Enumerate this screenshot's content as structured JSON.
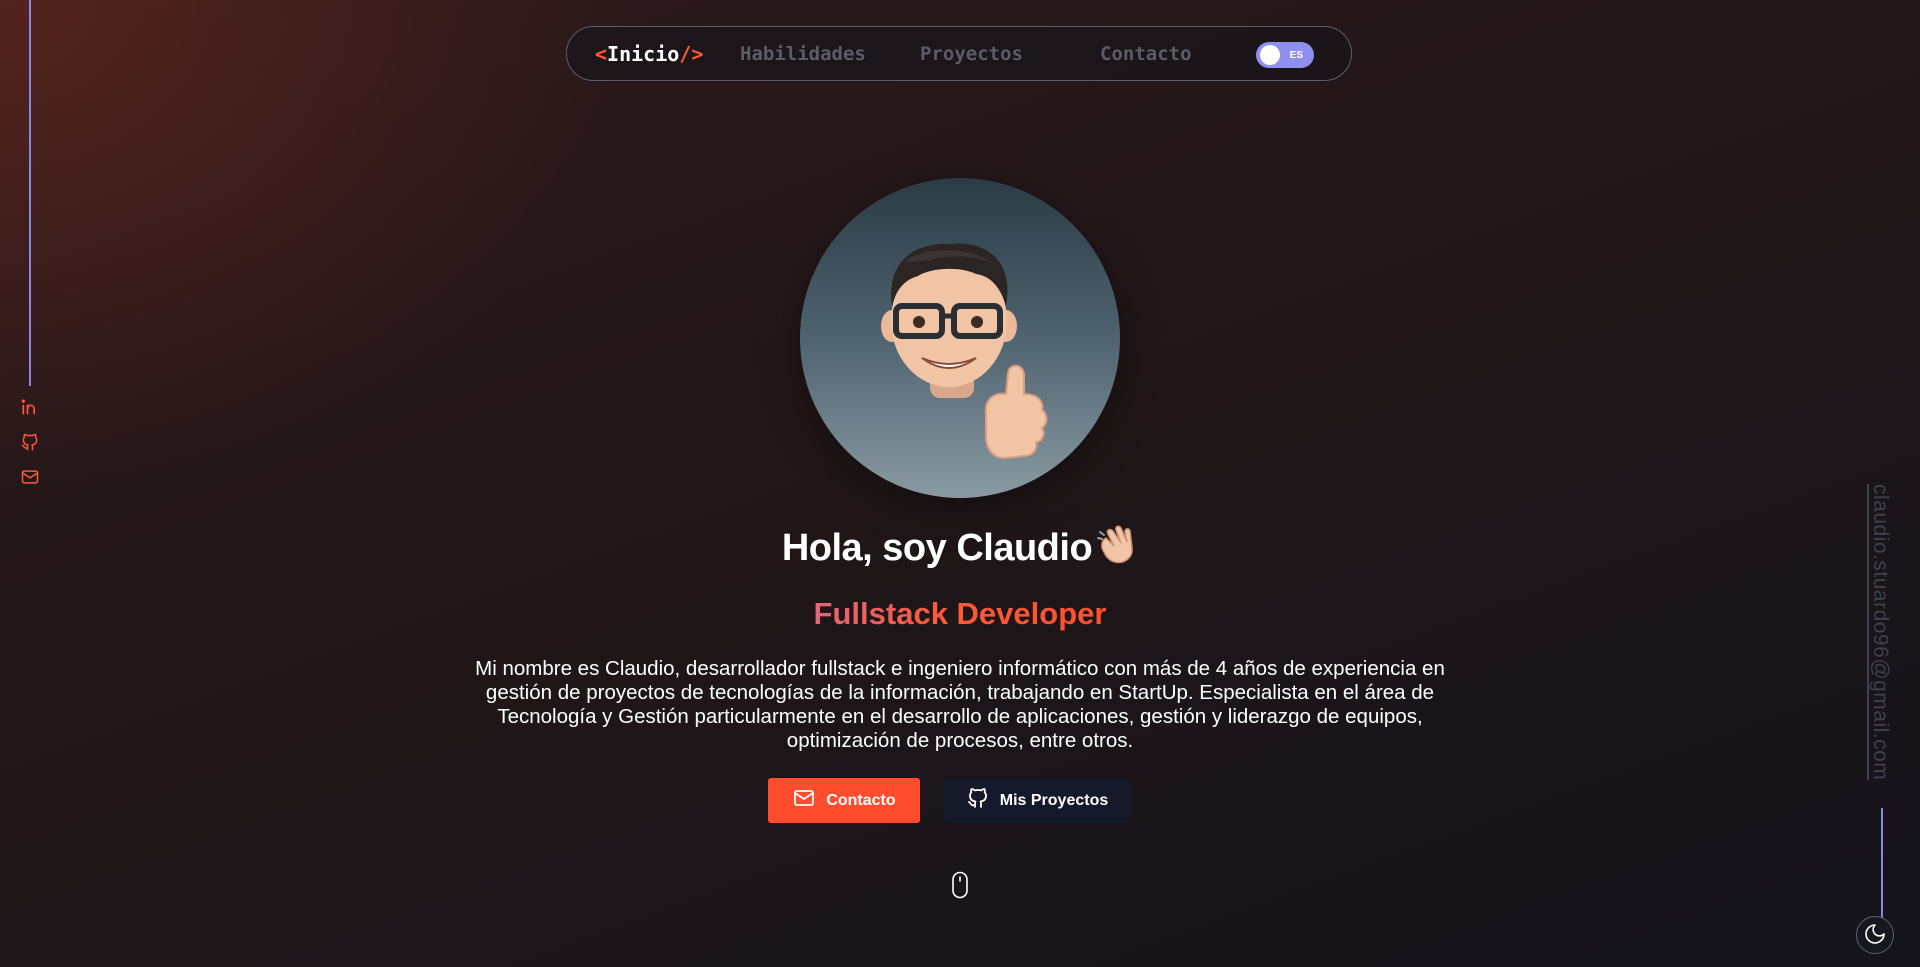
{
  "nav": {
    "brand": {
      "open": "<",
      "text": "Inicio",
      "close": "/>"
    },
    "links": [
      "Habilidades",
      "Proyectos",
      "Contacto"
    ],
    "lang_toggle": "ES"
  },
  "social": {
    "icons": [
      "linkedin-icon",
      "github-icon",
      "mail-icon"
    ]
  },
  "sidebar_email": "claudio.stuardo96@gmail.com",
  "hero": {
    "avatar": "memoji-thumbs-up",
    "title": "Hola, soy Claudio",
    "title_emoji": "waving-hand",
    "role": "Fullstack Developer",
    "description": "Mi nombre es Claudio, desarrollador fullstack e ingeniero informático con más de 4 años de experiencia en gestión de proyectos de tecnologías de la información, trabajando en StartUp. Especialista en el área de Tecnología y Gestión particularmente en el desarrollo de aplicaciones, gestión y liderazgo de equipos, optimización de procesos, entre otros.",
    "buttons": {
      "contact": "Contacto",
      "projects": "Mis Proyectos"
    }
  },
  "colors": {
    "accent": "#ff4d2e",
    "line": "#8a87e0",
    "toggle": "#8f8ff0",
    "nav_link": "#5a5d68"
  },
  "theme_toggle_icon": "moon-icon",
  "scroll_indicator_icon": "mouse-icon"
}
